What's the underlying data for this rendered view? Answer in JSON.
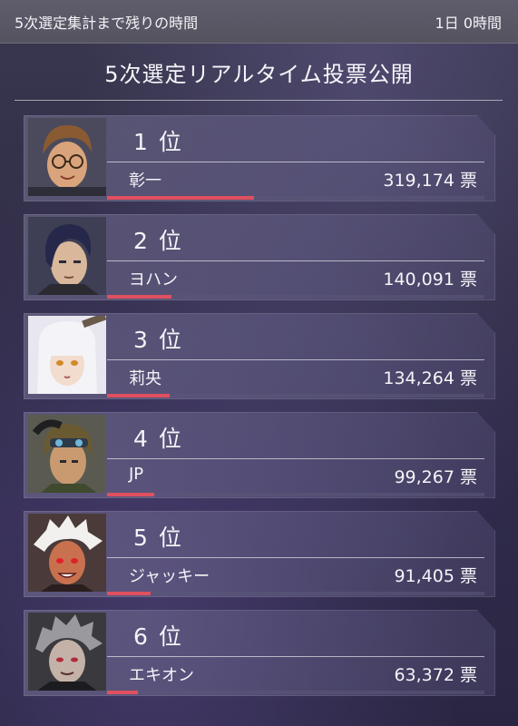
{
  "topbar": {
    "countdown_label": "5次選定集計まで残りの時間",
    "countdown_value": "1日 0時間"
  },
  "title": "5次選定リアルタイム投票公開",
  "colors": {
    "accent_bar": "#e0505f",
    "card": "#77739a"
  },
  "rankings": [
    {
      "rank": "1 位",
      "name": "彰一",
      "votes": "319,174 票",
      "portrait": "glasses-man-portrait",
      "vote_share": 0.39
    },
    {
      "rank": "2 位",
      "name": "ヨハン",
      "votes": "140,091 票",
      "portrait": "dark-haired-man-portrait",
      "vote_share": 0.17
    },
    {
      "rank": "3 位",
      "name": "莉央",
      "votes": "134,264 票",
      "portrait": "white-haired-girl-portrait",
      "vote_share": 0.165
    },
    {
      "rank": "4 位",
      "name": "JP",
      "votes": "99,267 票",
      "portrait": "goggles-man-portrait",
      "vote_share": 0.125
    },
    {
      "rank": "5 位",
      "name": "ジャッキー",
      "votes": "91,405 票",
      "portrait": "white-haired-red-man-portrait",
      "vote_share": 0.115
    },
    {
      "rank": "6 位",
      "name": "エキオン",
      "votes": "63,372 票",
      "portrait": "silver-haired-man-portrait",
      "vote_share": 0.08
    }
  ]
}
